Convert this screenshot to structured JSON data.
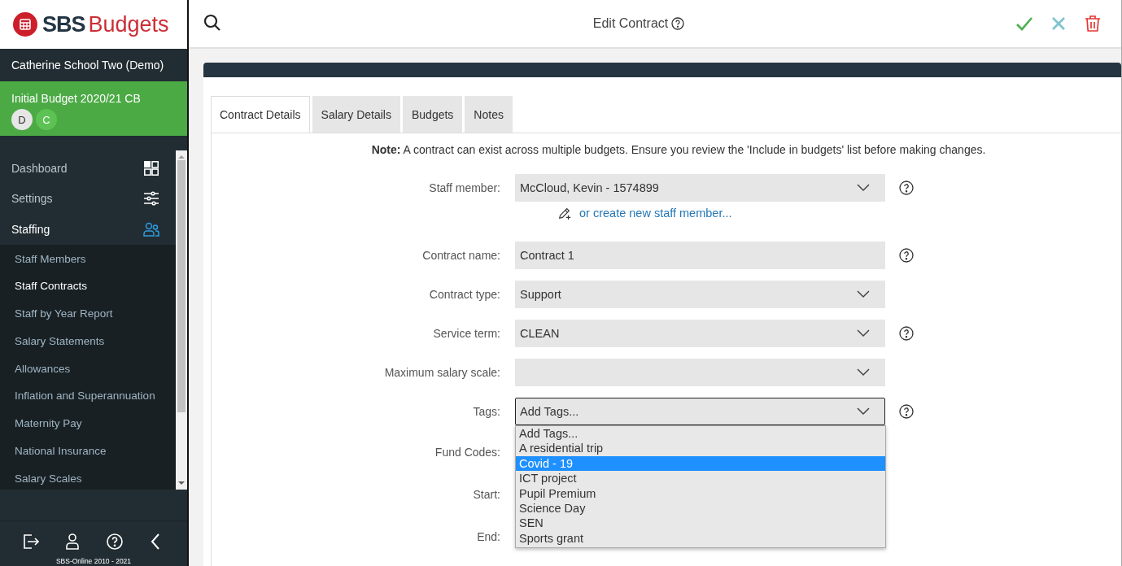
{
  "logo": {
    "mark": "SBS",
    "word": "Budgets"
  },
  "school": "Catherine School Two (Demo)",
  "budget": {
    "name": "Initial Budget 2020/21 CB",
    "avatars": [
      "D",
      "C"
    ]
  },
  "nav": [
    {
      "label": "Dashboard",
      "selected": false
    },
    {
      "label": "Settings",
      "selected": false
    },
    {
      "label": "Staffing",
      "selected": true
    }
  ],
  "subnav": [
    {
      "label": "Staff Members",
      "selected": false
    },
    {
      "label": "Staff Contracts",
      "selected": true
    },
    {
      "label": "Staff by Year Report",
      "selected": false
    },
    {
      "label": "Salary Statements",
      "selected": false
    },
    {
      "label": "Allowances",
      "selected": false
    },
    {
      "label": "Inflation and Superannuation",
      "selected": false
    },
    {
      "label": "Maternity Pay",
      "selected": false
    },
    {
      "label": "National Insurance",
      "selected": false
    },
    {
      "label": "Salary Scales",
      "selected": false
    }
  ],
  "footer": {
    "copyright": "SBS-Online 2010 - 2021"
  },
  "header": {
    "title": "Edit Contract"
  },
  "tabs": [
    {
      "label": "Contract Details",
      "selected": true
    },
    {
      "label": "Salary Details",
      "selected": false
    },
    {
      "label": "Budgets",
      "selected": false
    },
    {
      "label": "Notes",
      "selected": false
    }
  ],
  "note": "**Note:** A contract can exist across multiple budgets. Ensure you review the 'Include in budgets' list before making changes.",
  "fields": [
    {
      "label": "Staff member:",
      "kind": "select",
      "value": "McCloud, Kevin - 1574899",
      "help": true,
      "focused": false
    },
    {
      "kind": "link",
      "value": "or create new staff member..."
    },
    {
      "label": "Contract name:",
      "kind": "text",
      "value": "Contract 1",
      "help": true,
      "focused": false
    },
    {
      "label": "Contract type:",
      "kind": "select",
      "value": "Support",
      "help": false,
      "focused": false
    },
    {
      "label": "Service term:",
      "kind": "select",
      "value": "CLEAN",
      "help": true,
      "focused": false
    },
    {
      "label": "Maximum salary scale:",
      "kind": "select",
      "help": false,
      "focused": false
    },
    {
      "label": "Tags:",
      "kind": "select",
      "placeholder": "Add Tags...",
      "help": true,
      "focused": true,
      "options": [
        {
          "label": "Add Tags...",
          "selected": false
        },
        {
          "label": "A residential trip",
          "selected": false
        },
        {
          "label": "Covid - 19",
          "selected": true
        },
        {
          "label": "ICT project",
          "selected": false
        },
        {
          "label": "Pupil Premium",
          "selected": false
        },
        {
          "label": "Science Day",
          "selected": false
        },
        {
          "label": "SEN",
          "selected": false
        },
        {
          "label": "Sports grant",
          "selected": false
        }
      ]
    },
    {
      "label": "Fund Codes:",
      "kind": "hidden"
    },
    {
      "label": "Start:",
      "kind": "hidden"
    },
    {
      "label": "End:",
      "kind": "hidden"
    }
  ]
}
